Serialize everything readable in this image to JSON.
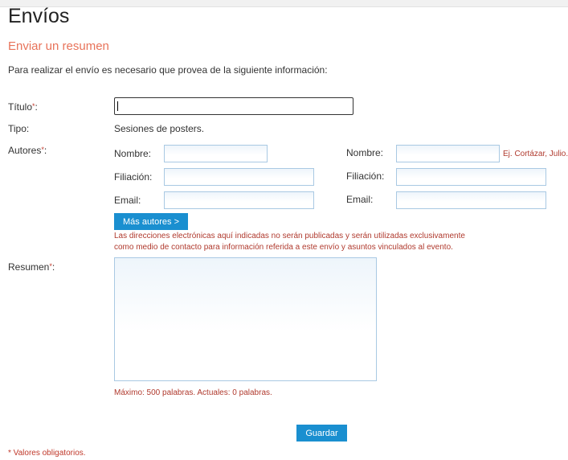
{
  "page": {
    "title": "Envíos",
    "section_title": "Enviar un resumen",
    "intro": "Para realizar el envío es necesario que provea de la siguiente información:"
  },
  "form": {
    "required_mark": "*",
    "titulo_label": "Título",
    "titulo_value": "",
    "tipo_label": "Tipo:",
    "tipo_value": "Sesiones de posters.",
    "autores_label": "Autores",
    "author_fields": {
      "nombre_label": "Nombre:",
      "filiacion_label": "Filiación:",
      "email_label": "Email:"
    },
    "nombre_example": "Ej. Cortázar, Julio.",
    "mas_autores_button": "Más autores >",
    "email_note_line1": "Las direcciones electrónicas aquí indicadas no serán publicadas y serán utilizadas exclusivamente",
    "email_note_line2": "como medio de contacto para información referida a este envío y asuntos vinculados al evento.",
    "resumen_label": "Resumen",
    "resumen_value": "",
    "word_count": "Máximo: 500 palabras. Actuales: 0 palabras.",
    "guardar_button": "Guardar",
    "footer_note": "* Valores obligatorios."
  },
  "colors": {
    "accent": "#1a8fd0",
    "section_title": "#e8735a",
    "required": "#c0392b"
  }
}
